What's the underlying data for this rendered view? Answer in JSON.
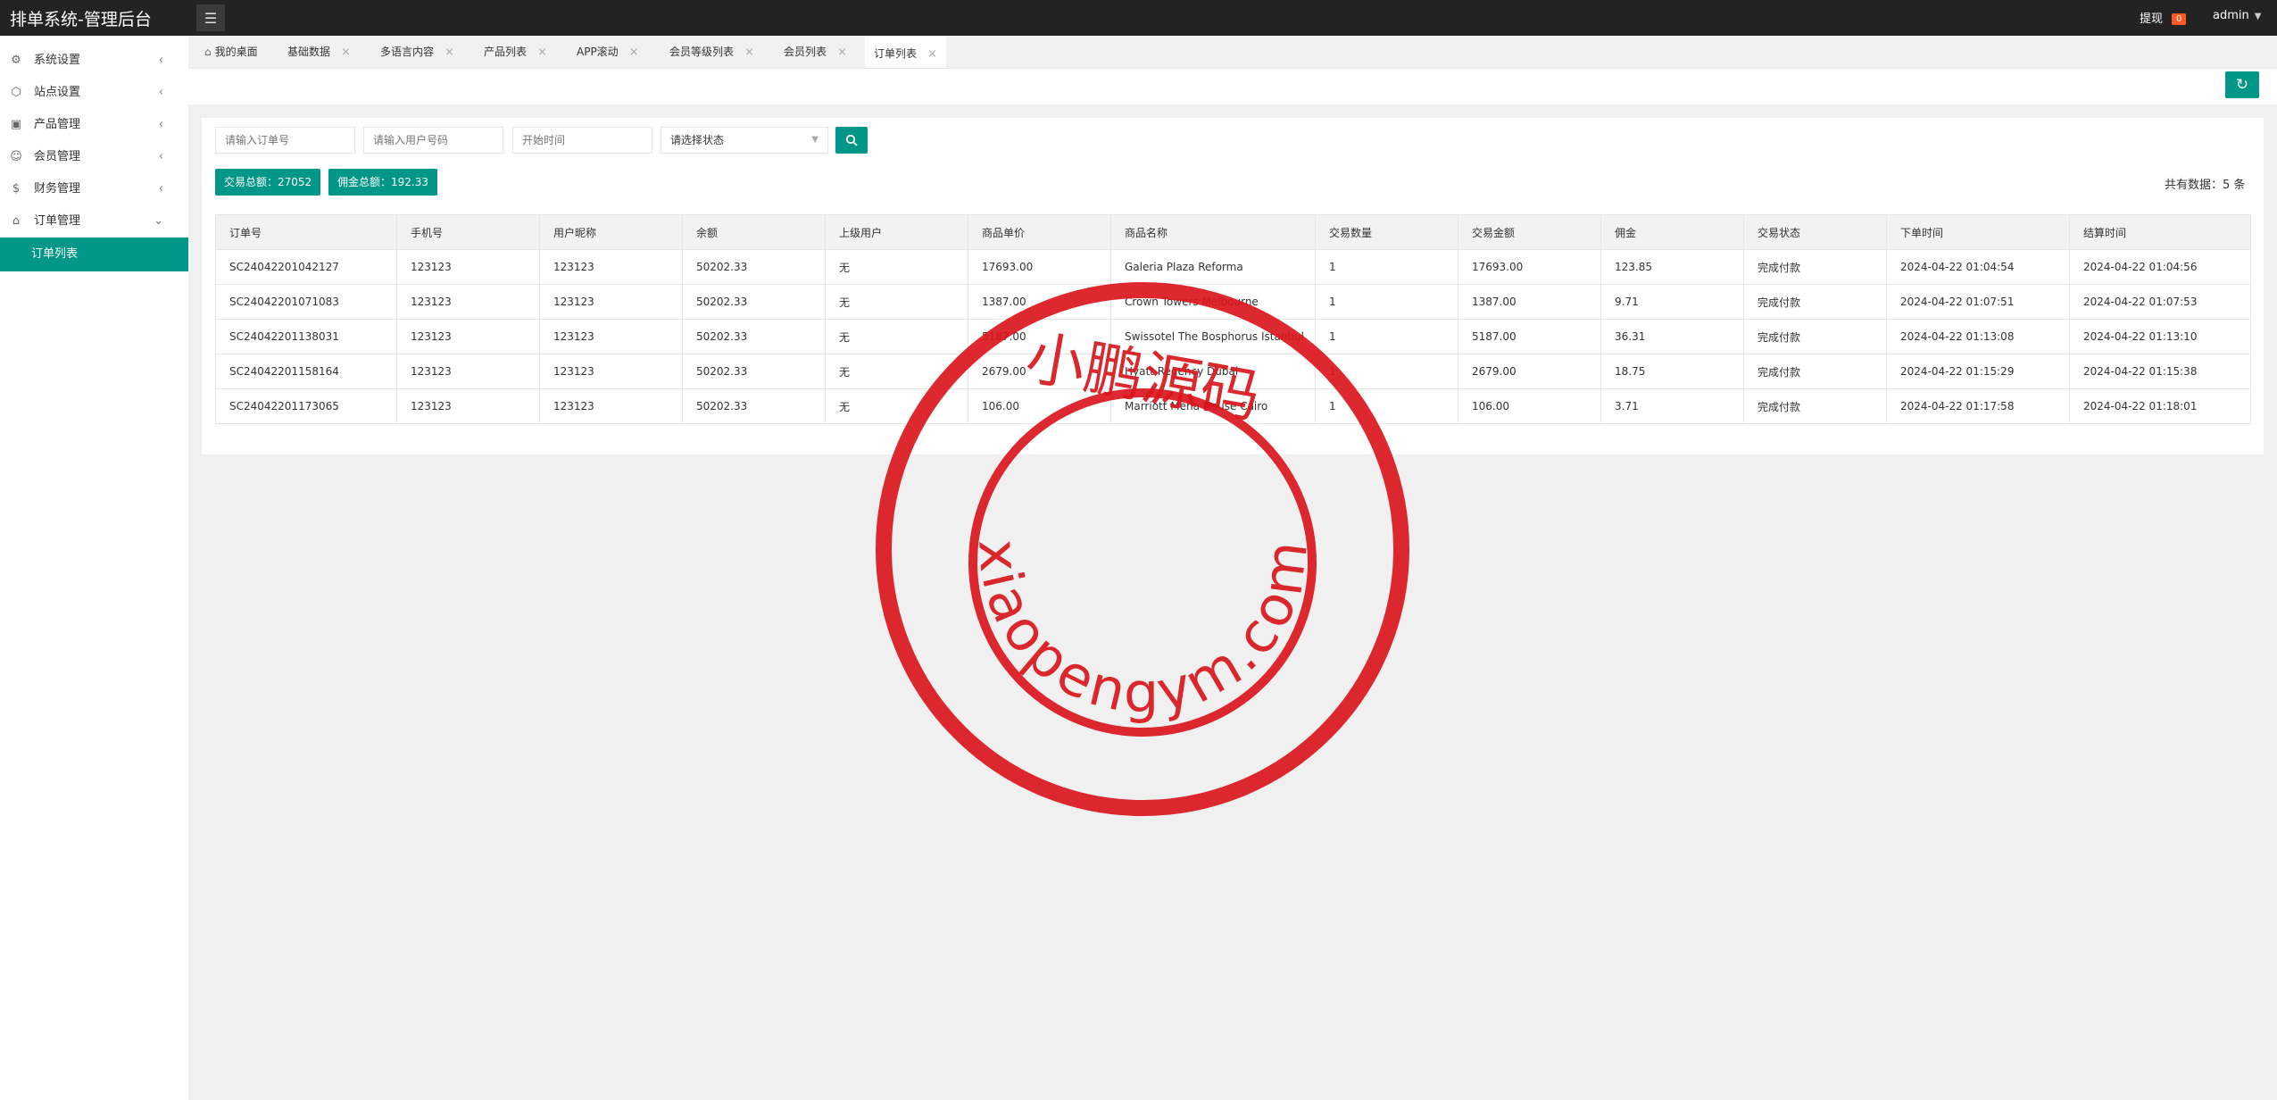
{
  "app": {
    "title": "排单系统-管理后台"
  },
  "header": {
    "withdraw_label": "提现",
    "withdraw_count": "0",
    "user": "admin"
  },
  "sidebar": {
    "items": [
      {
        "label": "系统设置",
        "icon": "gear-icon"
      },
      {
        "label": "站点设置",
        "icon": "site-icon"
      },
      {
        "label": "产品管理",
        "icon": "box-icon"
      },
      {
        "label": "会员管理",
        "icon": "user-icon"
      },
      {
        "label": "财务管理",
        "icon": "money-icon"
      },
      {
        "label": "订单管理",
        "icon": "order-icon"
      }
    ],
    "subitem": "订单列表"
  },
  "tabs": [
    {
      "label": "我的桌面"
    },
    {
      "label": "基础数据"
    },
    {
      "label": "多语言内容"
    },
    {
      "label": "产品列表"
    },
    {
      "label": "APP滚动"
    },
    {
      "label": "会员等级列表"
    },
    {
      "label": "会员列表"
    },
    {
      "label": "订单列表"
    }
  ],
  "filters": {
    "order_no_placeholder": "请输入订单号",
    "phone_placeholder": "请输入用户号码",
    "start_time_placeholder": "开始时间",
    "status_select": "请选择状态"
  },
  "stats": {
    "trade_total": "交易总额：27052",
    "commission_total": "佣金总额：192.33",
    "record_count": "共有数据：5 条"
  },
  "table": {
    "columns": [
      "订单号",
      "手机号",
      "用户昵称",
      "余额",
      "上级用户",
      "商品单价",
      "商品名称",
      "交易数量",
      "交易金额",
      "佣金",
      "交易状态",
      "下单时间",
      "结算时间"
    ],
    "rows": [
      [
        "SC24042201042127",
        "123123",
        "123123",
        "50202.33",
        "无",
        "17693.00",
        "Galeria Plaza Reforma",
        "1",
        "17693.00",
        "123.85",
        "完成付款",
        "2024-04-22 01:04:54",
        "2024-04-22 01:04:56"
      ],
      [
        "SC24042201071083",
        "123123",
        "123123",
        "50202.33",
        "无",
        "1387.00",
        "Crown Towers Melbourne",
        "1",
        "1387.00",
        "9.71",
        "完成付款",
        "2024-04-22 01:07:51",
        "2024-04-22 01:07:53"
      ],
      [
        "SC24042201138031",
        "123123",
        "123123",
        "50202.33",
        "无",
        "5187.00",
        "Swissotel The Bosphorus Istanbul",
        "1",
        "5187.00",
        "36.31",
        "完成付款",
        "2024-04-22 01:13:08",
        "2024-04-22 01:13:10"
      ],
      [
        "SC24042201158164",
        "123123",
        "123123",
        "50202.33",
        "无",
        "2679.00",
        "Hyatt Regency Dubai",
        "1",
        "2679.00",
        "18.75",
        "完成付款",
        "2024-04-22 01:15:29",
        "2024-04-22 01:15:38"
      ],
      [
        "SC24042201173065",
        "123123",
        "123123",
        "50202.33",
        "无",
        "106.00",
        "Marriott Mena House Cairo",
        "1",
        "106.00",
        "3.71",
        "完成付款",
        "2024-04-22 01:17:58",
        "2024-04-22 01:18:01"
      ]
    ]
  },
  "watermark": {
    "title": "小鹏源码",
    "url": "xiaopengym.com",
    "color": "#d9161c"
  },
  "colors": {
    "accent": "#009688",
    "header_bg": "#232323",
    "badge": "#ff5722"
  }
}
